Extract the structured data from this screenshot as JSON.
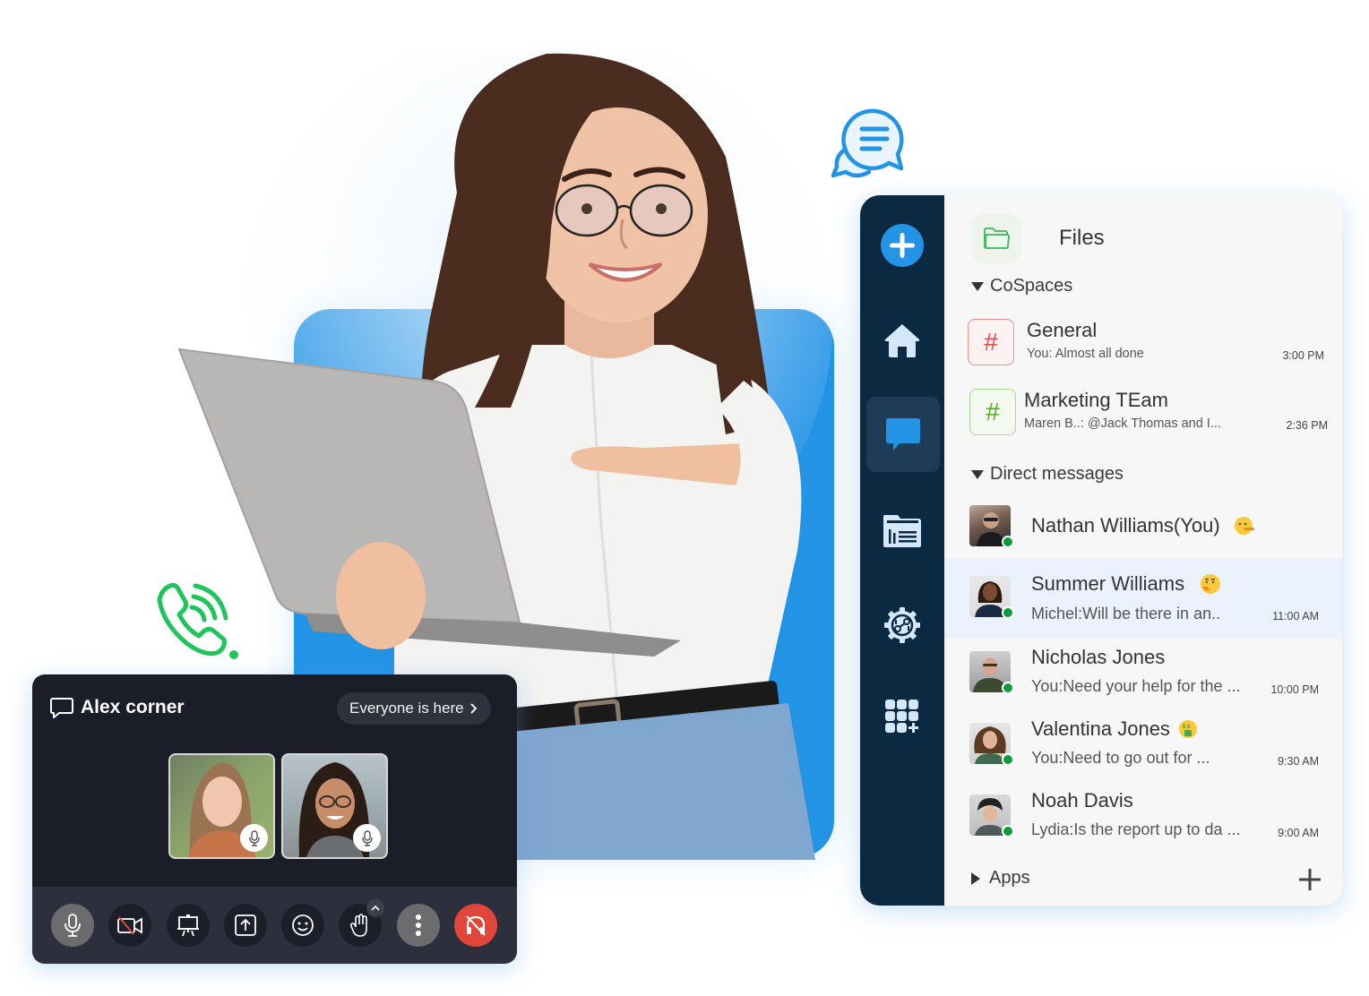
{
  "colors": {
    "brand_blue": "#2393e6",
    "rail_bg": "#0c2942",
    "online": "#0a9b3c",
    "hangup_red": "#e0463a",
    "call_bg": "#1b1d29",
    "phone_green": "#1fc55a"
  },
  "decor": {
    "chat_bubble_icon": "chat-bubbles-icon",
    "phone_icon": "phone-ringing-icon",
    "hero": "woman-holding-laptop"
  },
  "app": {
    "rail": [
      {
        "name": "new",
        "icon": "plus-circle-icon"
      },
      {
        "name": "home",
        "icon": "home-icon"
      },
      {
        "name": "chat",
        "icon": "chat-icon",
        "active": true
      },
      {
        "name": "news",
        "icon": "newspaper-icon"
      },
      {
        "name": "integrations",
        "icon": "gear-link-icon"
      },
      {
        "name": "apps",
        "icon": "apps-grid-add-icon"
      }
    ],
    "files_label": "Files",
    "cospaces_label": "CoSpaces",
    "channels": [
      {
        "name": "General",
        "preview": "You: Almost all done",
        "time": "3:00 PM",
        "color": "red"
      },
      {
        "name": "Marketing TEam",
        "preview": "Maren B..: @Jack Thomas and I...",
        "time": "2:36 PM",
        "color": "green"
      }
    ],
    "dm_label": "Direct messages",
    "direct_messages": [
      {
        "name": "Nathan Williams(You)",
        "emoji": "lying-face-emoji",
        "preview": "",
        "time": "",
        "online": true,
        "selected": false
      },
      {
        "name": "Summer Williams",
        "emoji": "thinking-face-emoji",
        "preview": "Michel:Will be there in an..",
        "time": "11:00 AM",
        "online": true,
        "selected": true
      },
      {
        "name": "Nicholas Jones",
        "emoji": "",
        "preview": "You:Need your help for the ...",
        "time": "10:00 PM",
        "online": true,
        "selected": false
      },
      {
        "name": "Valentina Jones",
        "emoji": "money-mouth-face-emoji",
        "preview": "You:Need to go out for ...",
        "time": "9:30 AM",
        "online": true,
        "selected": false
      },
      {
        "name": "Noah Davis",
        "emoji": "",
        "preview": "Lydia:Is the report up to da ...",
        "time": "9:00 AM",
        "online": true,
        "selected": false
      }
    ],
    "apps_label": "Apps"
  },
  "call": {
    "room_name": "Alex corner",
    "status_pill": "Everyone is here",
    "participants": [
      {
        "name": "participant-1",
        "mic": "mic-icon"
      },
      {
        "name": "participant-2",
        "mic": "mic-icon"
      }
    ],
    "controls": [
      "mic",
      "camera-off",
      "present",
      "share-screen",
      "reactions",
      "raise-hand",
      "more",
      "leave"
    ]
  }
}
